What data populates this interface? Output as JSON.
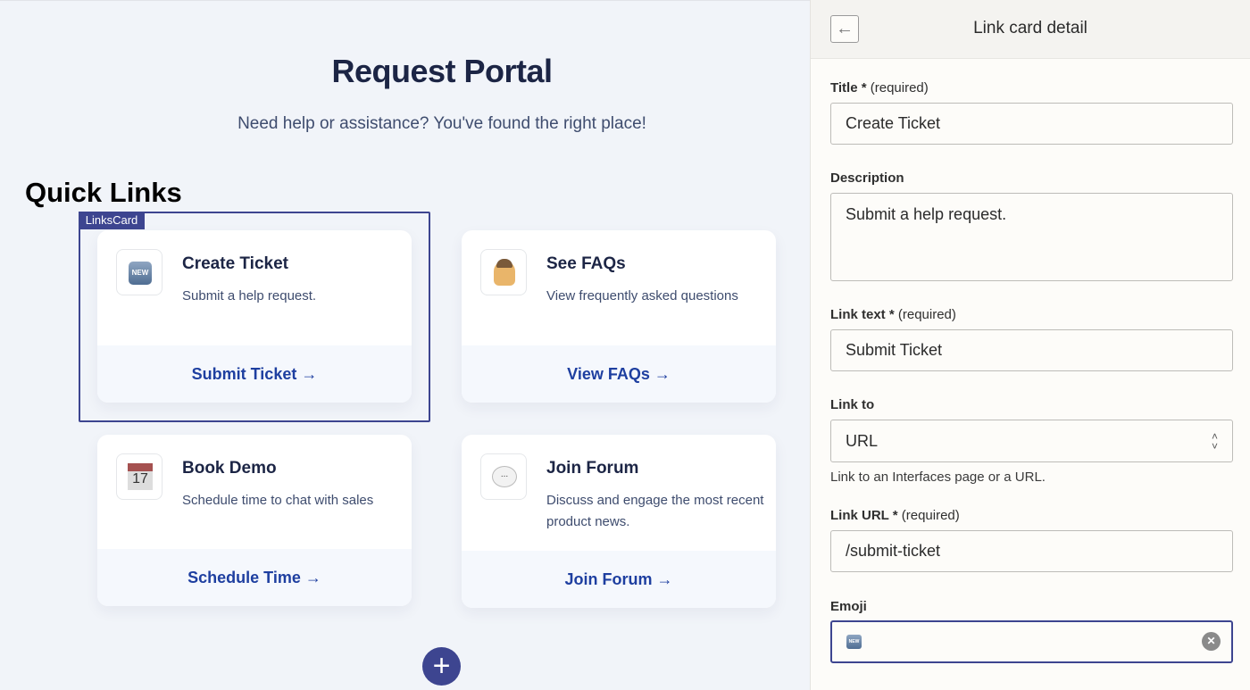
{
  "portal": {
    "title": "Request Portal",
    "subtitle": "Need help or assistance? You've found the right place!",
    "section_title": "Quick Links",
    "selection_tag": "LinksCard",
    "cards": [
      {
        "title": "Create Ticket",
        "description": "Submit a help request.",
        "link": "Submit Ticket →",
        "icon": "new-button-emoji",
        "icon_text": "NEW"
      },
      {
        "title": "See FAQs",
        "description": "View frequently asked questions",
        "link": "View FAQs →",
        "icon": "person-raising-hand-emoji"
      },
      {
        "title": "Book Demo",
        "description": "Schedule time to chat with sales",
        "link": "Schedule Time →",
        "icon": "calendar-emoji",
        "icon_text": "17"
      },
      {
        "title": "Join Forum",
        "description": "Discuss and engage the most recent product news.",
        "link": "Join Forum →",
        "icon": "speech-bubble-emoji",
        "icon_text": "..."
      }
    ],
    "add_label": "+"
  },
  "panel": {
    "back": "←",
    "title": "Link card detail",
    "title_label": "Title *",
    "title_req": "(required)",
    "title_value": "Create Ticket",
    "desc_label": "Description",
    "desc_value": "Submit a help request.",
    "linktext_label": "Link text *",
    "linktext_req": "(required)",
    "linktext_value": "Submit Ticket",
    "linkto_label": "Link to",
    "linkto_value": "URL",
    "linkto_help": "Link to an Interfaces page or a URL.",
    "url_label": "Link URL *",
    "url_req": "(required)",
    "url_value": "/submit-ticket",
    "emoji_label": "Emoji",
    "emoji_value_icon": "new-button-emoji",
    "emoji_icon_text": "NEW",
    "clear": "✕"
  },
  "colors": {
    "accent": "#3d4590",
    "link": "#1e3fa0",
    "heading": "#1c2545"
  }
}
